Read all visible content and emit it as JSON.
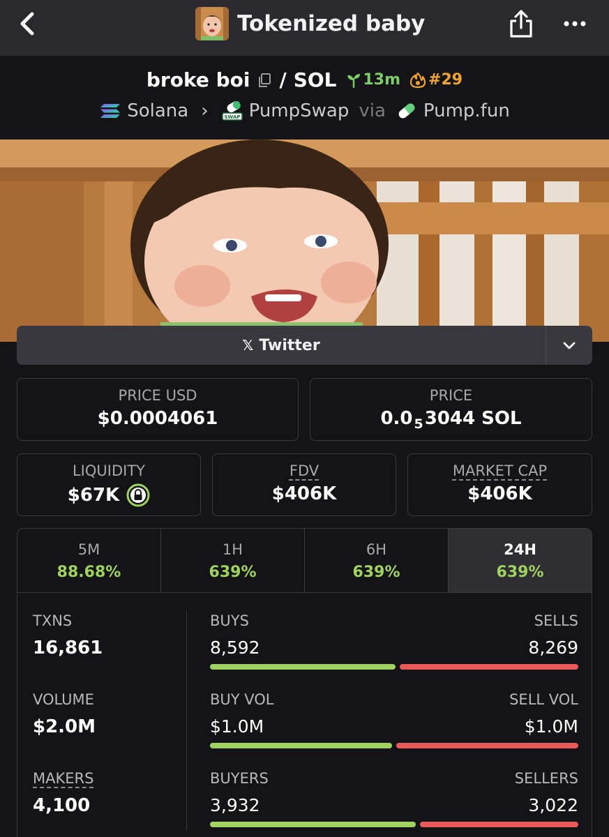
{
  "header": {
    "title": "Tokenized baby",
    "back_icon": "chevron-left-icon",
    "share_icon": "share-icon",
    "more_icon": "more-dots-icon"
  },
  "pair": {
    "base": "broke boi",
    "separator": "/",
    "quote": "SOL",
    "age": "13m",
    "rank": "#29",
    "chain": "Solana",
    "dex": "PumpSwap",
    "via": "via",
    "launchpad": "Pump.fun",
    "colors": {
      "age": "#7ccd68",
      "rank": "#f0a32e"
    }
  },
  "social": {
    "twitter_label": "Twitter",
    "x_glyph": "𝕏"
  },
  "prices": {
    "price_usd_label": "PRICE USD",
    "price_usd": "$0.0004061",
    "price_label": "PRICE",
    "price_sol_prefix": "0.0",
    "price_sol_sub": "5",
    "price_sol_suffix": "3044 SOL"
  },
  "metrics": {
    "liquidity_label": "LIQUIDITY",
    "liquidity": "$67K",
    "fdv_label": "FDV",
    "fdv": "$406K",
    "mcap_label": "MARKET CAP",
    "mcap": "$406K"
  },
  "timeframes": [
    {
      "label": "5M",
      "change": "88.68%"
    },
    {
      "label": "1H",
      "change": "639%"
    },
    {
      "label": "6H",
      "change": "639%"
    },
    {
      "label": "24H",
      "change": "639%",
      "active": true
    }
  ],
  "stats": {
    "txns_label": "TXNS",
    "txns": "16,861",
    "volume_label": "VOLUME",
    "volume": "$2.0M",
    "makers_label": "MAKERS",
    "makers": "4,100",
    "buys_label": "BUYS",
    "buys": "8,592",
    "sells_label": "SELLS",
    "sells": "8,269",
    "buy_vol_label": "BUY VOL",
    "buy_vol": "$1.0M",
    "sell_vol_label": "SELL VOL",
    "sell_vol": "$1.0M",
    "buyers_label": "BUYERS",
    "buyers": "3,932",
    "sellers_label": "SELLERS",
    "sellers": "3,022",
    "buys_fraction": 0.51,
    "buy_vol_fraction": 0.5,
    "buyers_fraction": 0.565,
    "colors": {
      "buy": "#9fd260",
      "sell": "#ea5a5a"
    }
  }
}
